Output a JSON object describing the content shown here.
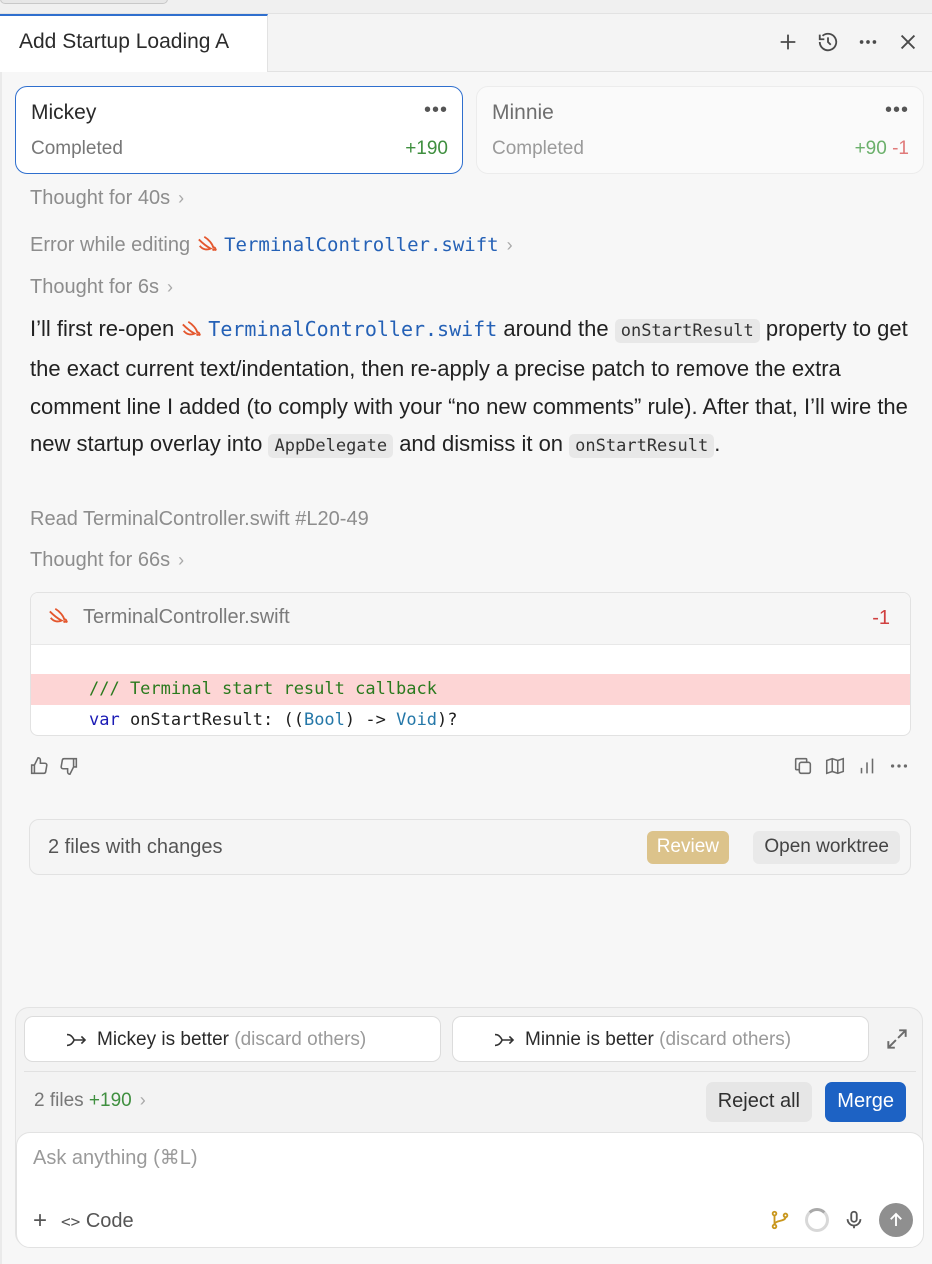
{
  "tab": {
    "title": "Add Startup Loading A"
  },
  "agents": [
    {
      "name": "Mickey",
      "status": "Completed",
      "added": "+190",
      "removed": ""
    },
    {
      "name": "Minnie",
      "status": "Completed",
      "added": "+90",
      "removed": "-1"
    }
  ],
  "log": {
    "thought1": "Thought for 40s",
    "error_prefix": "Error while editing",
    "error_file": "TerminalController.swift",
    "thought2": "Thought for 6s",
    "para": {
      "p1": "I’ll first re-open",
      "file": "TerminalController.swift",
      "p2": "around the",
      "code1": "onStartResult",
      "p3": "property to get the exact current text/indentation, then re-apply a precise patch to remove the extra comment line I added (to comply with your “no new comments” rule). After that, I’ll wire the new startup overlay into",
      "code2": "AppDelegate",
      "p4": "and dismiss it on",
      "code3": "onStartResult",
      "p5": "."
    },
    "read_line": "Read TerminalController.swift #L20-49",
    "thought3": "Thought for 66s"
  },
  "diff": {
    "file": "TerminalController.swift",
    "count": "-1",
    "removed_line": "/// Terminal start result callback",
    "context": {
      "kw": "var",
      "a": " onStartResult: ((",
      "t1": "Bool",
      "b": ") -> ",
      "t2": "Void",
      "c": ")?"
    }
  },
  "changes": {
    "label": "2 files with changes",
    "review": "Review",
    "worktree": "Open worktree"
  },
  "choices": {
    "a_main": "Mickey is better",
    "a_sub": "(discard others)",
    "b_main": "Minnie is better",
    "b_sub": "(discard others)"
  },
  "summary": {
    "files": "2 files",
    "added": "+190"
  },
  "actions": {
    "reject": "Reject all",
    "merge": "Merge"
  },
  "composer": {
    "placeholder": "Ask anything (⌘L)",
    "mode": "Code"
  },
  "colors": {
    "accent": "#1d62c4",
    "added": "#3f8f3f",
    "removed": "#d04040",
    "review": "#dcc38b"
  }
}
